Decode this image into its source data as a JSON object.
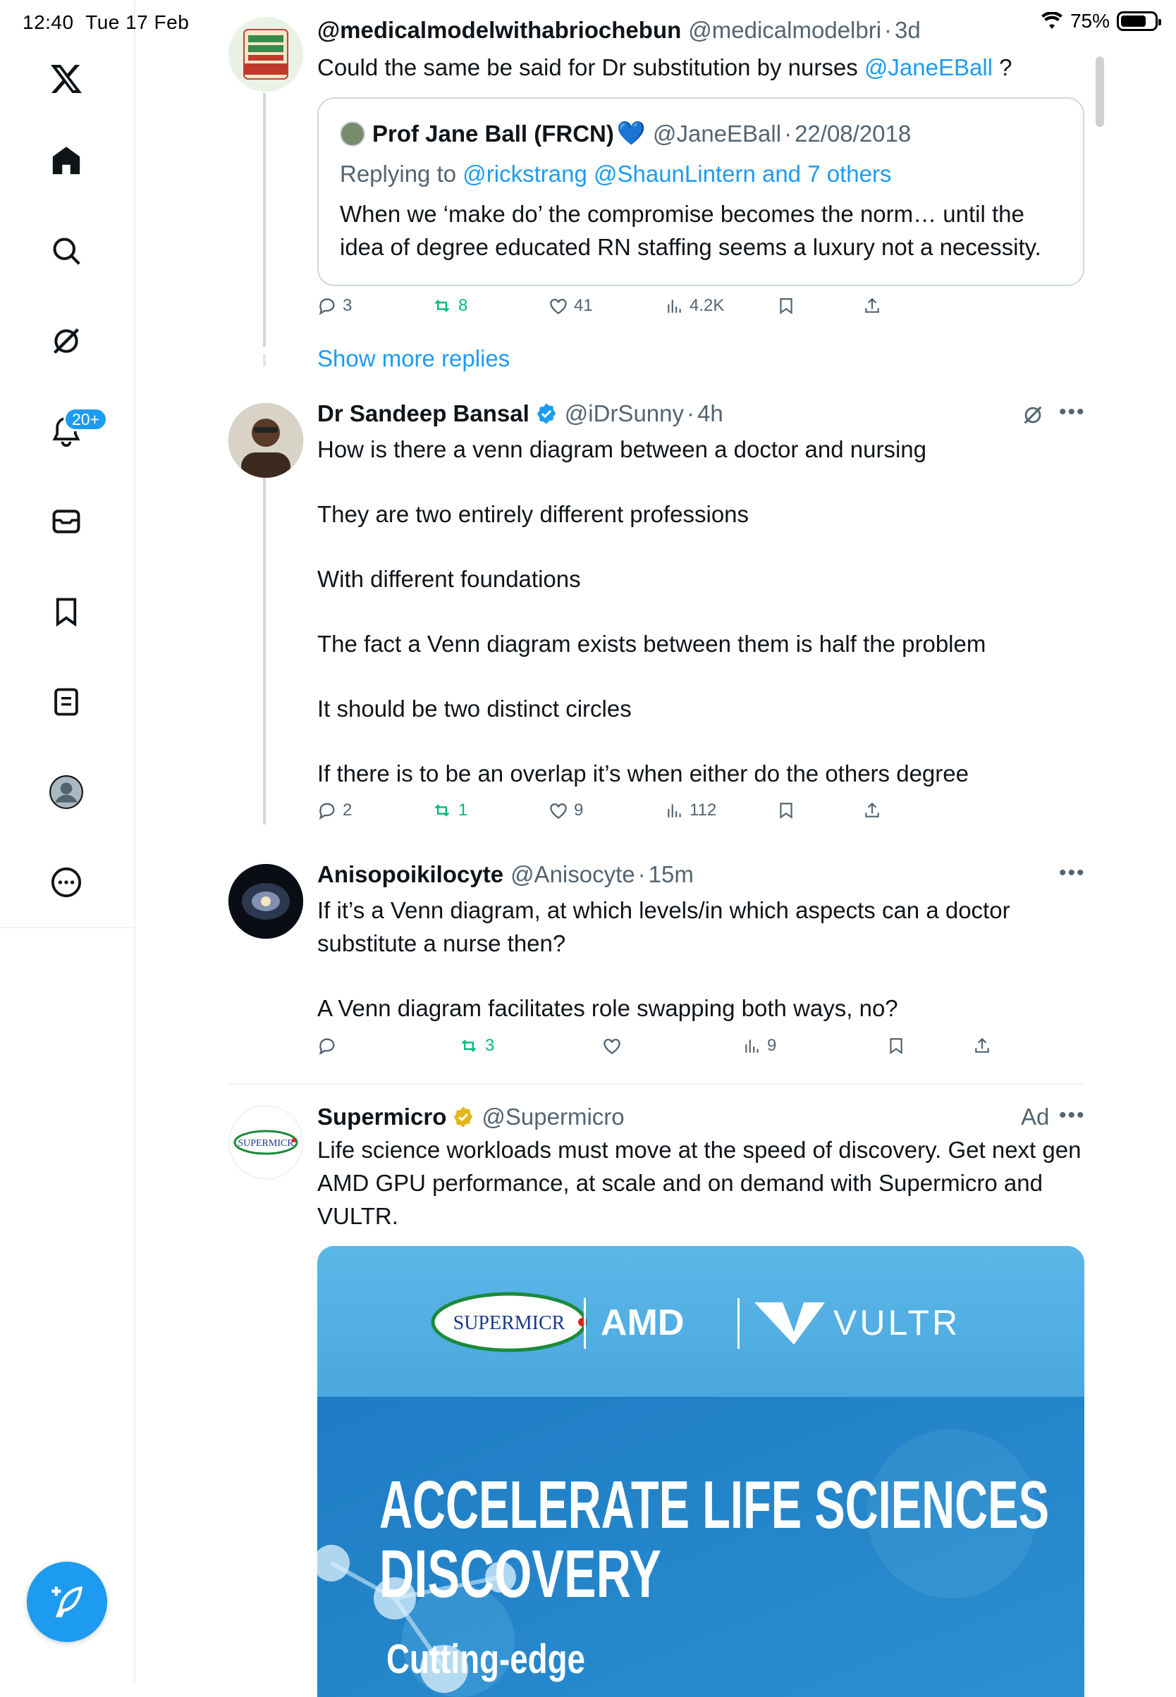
{
  "status_bar": {
    "time": "12:40",
    "date": "Tue 17 Feb",
    "battery": "75%",
    "battery_level": 0.75
  },
  "sidebar": {
    "items": [
      {
        "icon": "x-logo-icon"
      },
      {
        "icon": "home-icon"
      },
      {
        "icon": "search-icon"
      },
      {
        "icon": "grok-icon"
      },
      {
        "icon": "bell-icon",
        "badge": "20+"
      },
      {
        "icon": "mail-icon"
      },
      {
        "icon": "bookmark-icon"
      },
      {
        "icon": "lists-icon"
      },
      {
        "icon": "profile-icon"
      },
      {
        "icon": "more-icon"
      }
    ],
    "compose_icon": "compose-feather-icon"
  },
  "tweets": [
    {
      "name": "@medicalmodelwithabriochebun",
      "handle": "@medicalmodelbri",
      "time": "3d",
      "text_before": "Could the same be said for Dr substitution by nurses ",
      "mention": "@JaneEBall",
      "text_after": " ?",
      "quote": {
        "name": "Prof Jane Ball (FRCN)",
        "emoji": "💙",
        "handle": "@JaneEBall",
        "date": "22/08/2018",
        "replying_label": "Replying to ",
        "replying_to": "@rickstrang @ShaunLintern and 7 others",
        "text": "When we ‘make do’ the compromise becomes the norm… until the idea of degree educated RN staffing seems a luxury not a necessity."
      },
      "replies": "3",
      "reposts": "8",
      "likes": "41",
      "views": "4.2K"
    },
    {
      "name": "Dr Sandeep Bansal",
      "handle": "@iDrSunny",
      "time": "4h",
      "paragraphs": [
        "How is there a venn diagram between a doctor and nursing",
        "They are two entirely different professions",
        "With different foundations",
        "The fact a Venn diagram exists between them is half the problem",
        "It should be two distinct circles",
        "If there is to be an overlap it’s when either do the others degree"
      ],
      "replies": "2",
      "reposts": "1",
      "likes": "9",
      "views": "112"
    },
    {
      "name": "Anisopoikilocyte",
      "handle": "@Anisocyte",
      "time": "15m",
      "paragraphs": [
        "If it’s a Venn diagram, at which levels/in which aspects can a doctor substitute a nurse then?",
        "A Venn diagram facilitates role swapping both ways, no?"
      ],
      "reposts": "3",
      "views": "9"
    },
    {
      "name": "Supermicro",
      "handle": "@Supermicro",
      "ad_label": "Ad",
      "text": "Life science workloads must move at the speed of discovery. Get next gen AMD GPU performance, at scale and on demand with Supermicro and VULTR.",
      "image": {
        "logo_supermicro": "SUPERMICR",
        "logo_amd": "AMD",
        "logo_vultr": "VULTR",
        "headline_1": "ACCELERATE LIFE SCIENCES",
        "headline_2": "DISCOVERY",
        "subline": "Cutting-edge"
      }
    }
  ],
  "show_more": "Show more replies",
  "colors": {
    "accent": "#1d9bf0",
    "repost": "#00ba7c",
    "muted": "#536471",
    "verified_gold": "#e2b719"
  }
}
